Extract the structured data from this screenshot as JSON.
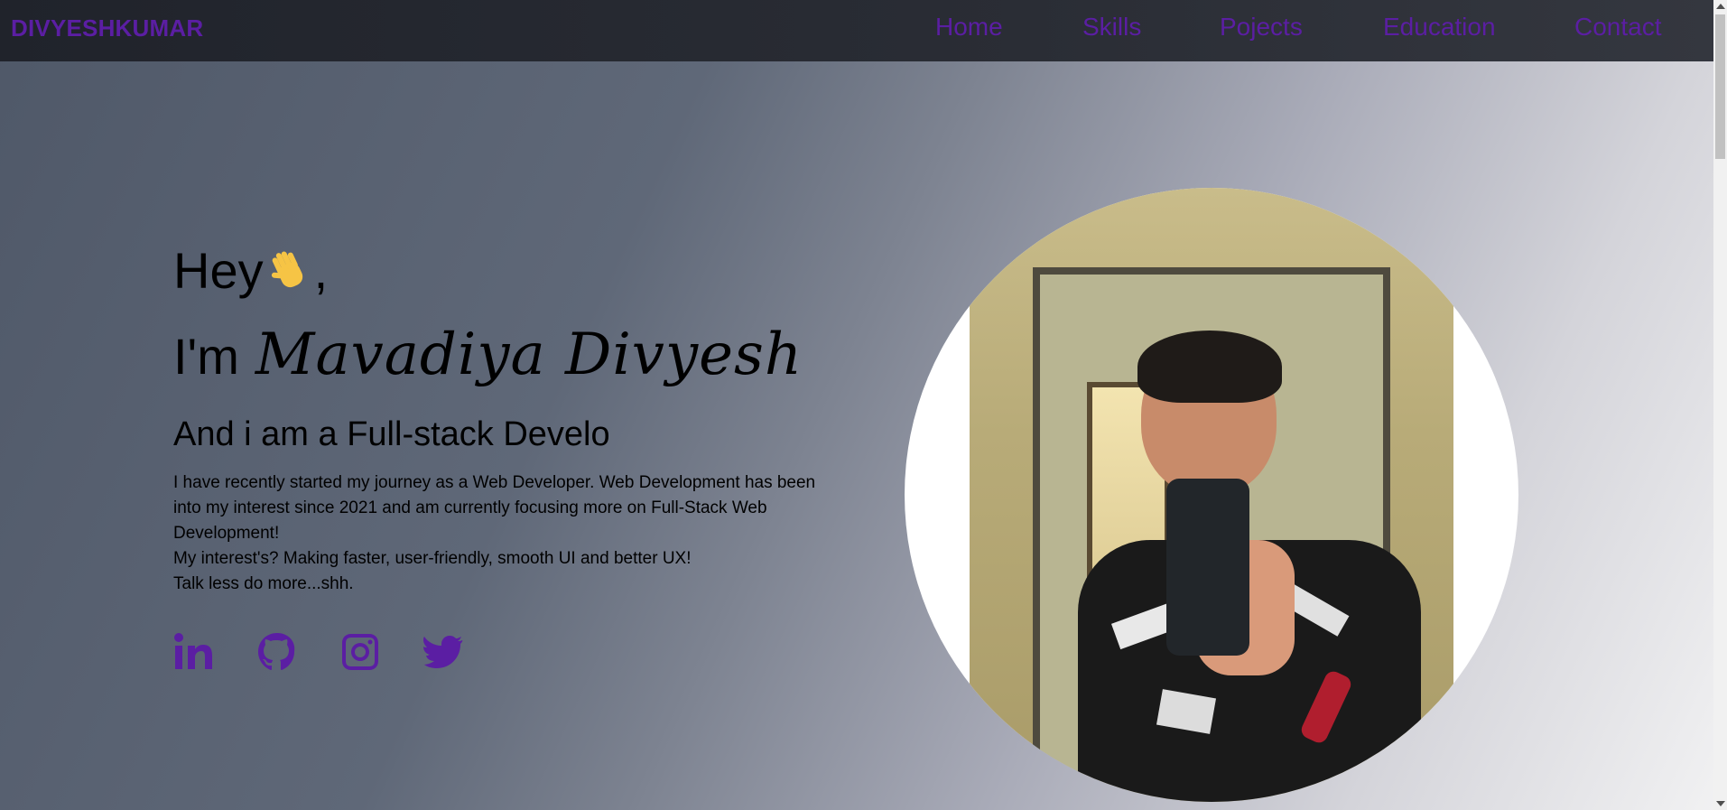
{
  "nav": {
    "brand": "DIVYESHKUMAR",
    "links": [
      "Home",
      "Skills",
      "Pojects",
      "Education",
      "Contact"
    ]
  },
  "hero": {
    "greeting": "Hey",
    "greeting_suffix": ",",
    "intro_prefix": "I'm",
    "name": "Mavadiya Divyesh",
    "role": "And i am a Full-stack Develo",
    "bio": [
      "I have recently started my journey as a Web Developer. Web Development has been into my interest since 2021 and am currently focusing more on Full-Stack Web Development!",
      "My interest's? Making faster, user-friendly, smooth UI and better UX!",
      "Talk less do more...shh."
    ]
  },
  "socials": [
    {
      "icon": "linkedin-icon"
    },
    {
      "icon": "github-icon"
    },
    {
      "icon": "instagram-icon"
    },
    {
      "icon": "twitter-icon"
    }
  ],
  "colors": {
    "accent": "#5b1ea3",
    "navbar": "#2a2d35"
  }
}
